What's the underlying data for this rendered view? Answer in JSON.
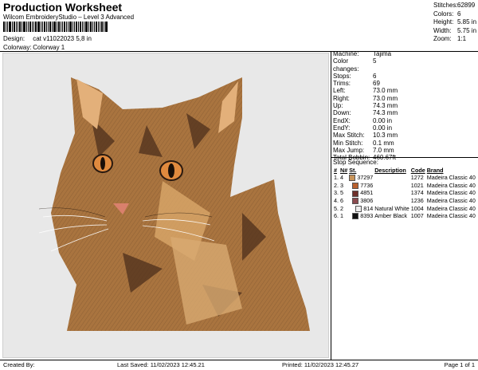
{
  "header": {
    "title": "Production Worksheet",
    "subtitle": "Wilcom EmbroideryStudio – Level 3 Advanced",
    "design_label": "Design:",
    "design_value": "cat v11022023 5,8 in",
    "colorway_label": "Colorway:",
    "colorway_value": "Colorway 1"
  },
  "stats": [
    {
      "label": "Stitches:",
      "value": "62899"
    },
    {
      "label": "Colors:",
      "value": "6"
    },
    {
      "label": "Height:",
      "value": "5.85 in"
    },
    {
      "label": "Width:",
      "value": "5.75 in"
    },
    {
      "label": "Zoom:",
      "value": "1:1"
    }
  ],
  "machine_info": [
    {
      "label": "Machine:",
      "value": "Tajima"
    },
    {
      "label": "Color changes:",
      "value": "5"
    },
    {
      "label": "Stops:",
      "value": "6"
    },
    {
      "label": "Trims:",
      "value": "69"
    },
    {
      "label": "Left:",
      "value": "73.0 mm"
    },
    {
      "label": "Right:",
      "value": "73.0 mm"
    },
    {
      "label": "Up:",
      "value": "74.3 mm"
    },
    {
      "label": "Down:",
      "value": "74.3 mm"
    },
    {
      "label": "EndX:",
      "value": "0.00 in"
    },
    {
      "label": "EndY:",
      "value": "0.00 in"
    },
    {
      "label": "Max Stitch:",
      "value": "10.3 mm"
    },
    {
      "label": "Min Stitch:",
      "value": "0.1 mm"
    },
    {
      "label": "Max Jump:",
      "value": "7.0 mm"
    },
    {
      "label": "Total Bobbin:",
      "value": "460.67ft"
    }
  ],
  "stop_sequence": {
    "title": "Stop Sequence:",
    "headers": [
      "#",
      "N#",
      "St.",
      "Description",
      "Code",
      "Brand"
    ],
    "rows": [
      {
        "idx": "1.",
        "n": "4",
        "color": "#c8945a",
        "st": "37297",
        "desc": "",
        "code": "1272",
        "brand": "Madeira Classic 40"
      },
      {
        "idx": "2.",
        "n": "3",
        "color": "#b8602e",
        "st": "7736",
        "desc": "",
        "code": "1021",
        "brand": "Madeira Classic 40"
      },
      {
        "idx": "3.",
        "n": "5",
        "color": "#6e2f2a",
        "st": "4851",
        "desc": "",
        "code": "1374",
        "brand": "Madeira Classic 40"
      },
      {
        "idx": "4.",
        "n": "6",
        "color": "#8a4a4e",
        "st": "3806",
        "desc": "",
        "code": "1236",
        "brand": "Madeira Classic 40"
      },
      {
        "idx": "5.",
        "n": "2",
        "color": "#eeeeee",
        "st": "814",
        "desc": "Natural White",
        "code": "1004",
        "brand": "Madeira Classic 40"
      },
      {
        "idx": "6.",
        "n": "1",
        "color": "#111111",
        "st": "8393",
        "desc": "Amber Black",
        "code": "1007",
        "brand": "Madeira Classic 40"
      }
    ]
  },
  "footer": {
    "created": "Created By:",
    "last_saved": "Last Saved: 11/02/2023 12:45.21",
    "printed": "Printed: 11/02/2023 12:45.27",
    "page": "Page 1 of 1"
  }
}
